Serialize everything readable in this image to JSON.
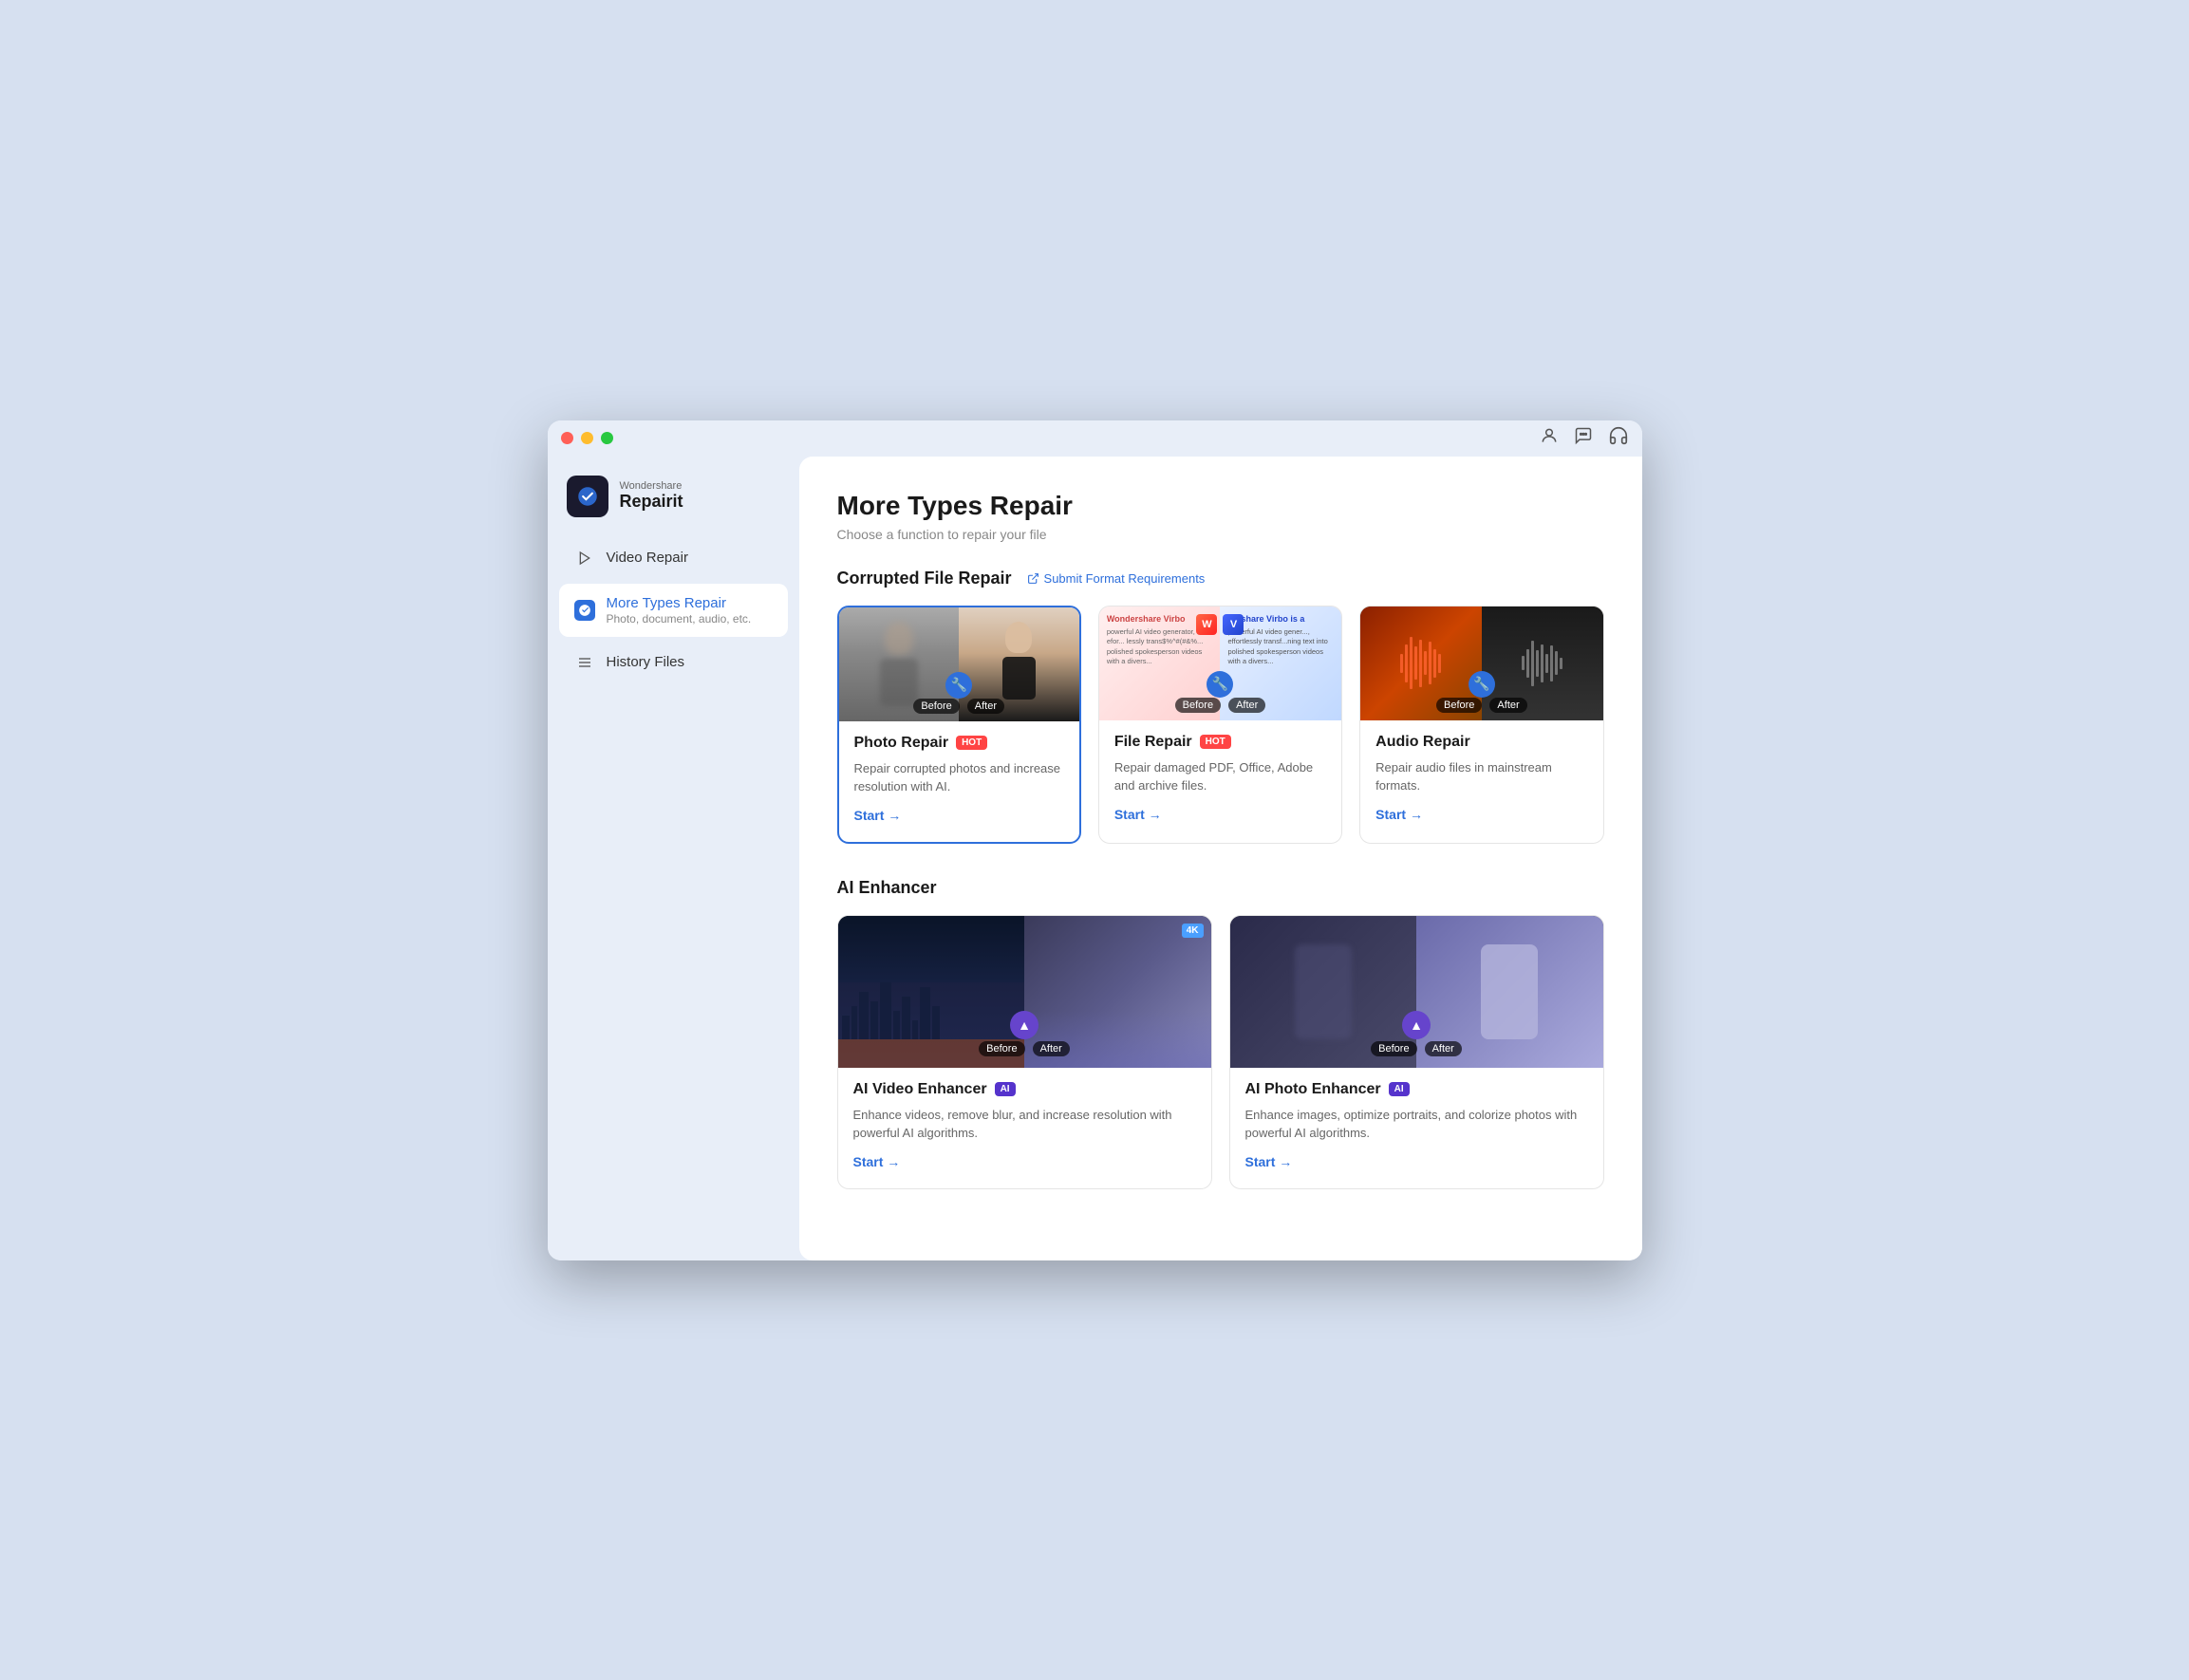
{
  "window": {
    "title": "Wondershare Repairit"
  },
  "titlebar": {
    "close_label": "●",
    "minimize_label": "●",
    "maximize_label": "●"
  },
  "logo": {
    "brand": "Wondershare",
    "product": "Repairit"
  },
  "sidebar": {
    "items": [
      {
        "id": "video-repair",
        "label": "Video Repair",
        "icon": "▶",
        "active": false
      },
      {
        "id": "more-types-repair",
        "label": "More Types Repair",
        "sublabel": "Photo, document, audio, etc.",
        "icon": "🔧",
        "active": true
      },
      {
        "id": "history-files",
        "label": "History Files",
        "icon": "≡",
        "active": false
      }
    ]
  },
  "page": {
    "title": "More Types Repair",
    "subtitle": "Choose a function to repair your file"
  },
  "corrupted_section": {
    "title": "Corrupted File Repair",
    "link_label": "Submit Format Requirements",
    "cards": [
      {
        "id": "photo-repair",
        "title": "Photo Repair",
        "badge": "HOT",
        "badge_type": "hot",
        "description": "Repair corrupted photos and increase resolution with AI.",
        "start_label": "Start →"
      },
      {
        "id": "file-repair",
        "title": "File Repair",
        "badge": "HOT",
        "badge_type": "hot",
        "description": "Repair damaged PDF, Office, Adobe and archive files.",
        "start_label": "Start →"
      },
      {
        "id": "audio-repair",
        "title": "Audio Repair",
        "badge": null,
        "description": "Repair audio files in mainstream formats.",
        "start_label": "Start →"
      }
    ]
  },
  "ai_section": {
    "title": "AI Enhancer",
    "cards": [
      {
        "id": "ai-video-enhancer",
        "title": "AI Video Enhancer",
        "badge": "AI",
        "badge_type": "ai",
        "description": "Enhance videos, remove blur, and increase resolution with powerful AI algorithms.",
        "start_label": "Start →"
      },
      {
        "id": "ai-photo-enhancer",
        "title": "AI Photo Enhancer",
        "badge": "AI",
        "badge_type": "ai",
        "description": "Enhance images, optimize portraits, and colorize photos with powerful AI algorithms.",
        "start_label": "Start →"
      }
    ]
  },
  "labels": {
    "before": "Before",
    "after": "After"
  }
}
